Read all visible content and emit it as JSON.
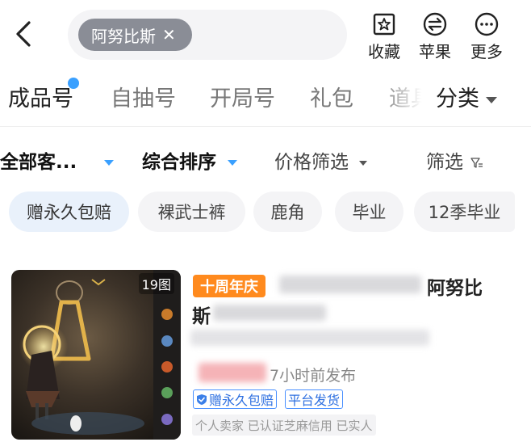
{
  "search": {
    "tag": "阿努比斯"
  },
  "header_actions": [
    {
      "label": "收藏",
      "icon": "star-box-icon"
    },
    {
      "label": "苹果",
      "icon": "apple-swap-icon"
    },
    {
      "label": "更多",
      "icon": "more-dots-icon"
    }
  ],
  "tabs": [
    {
      "label": "成品号",
      "active": true,
      "dot": true
    },
    {
      "label": "自抽号"
    },
    {
      "label": "开局号"
    },
    {
      "label": "礼包"
    },
    {
      "label": "道具"
    },
    {
      "label": "分类"
    }
  ],
  "filters": [
    {
      "label": "全部客..."
    },
    {
      "label": "综合排序",
      "active": true
    },
    {
      "label": "价格筛选"
    },
    {
      "label": "筛选"
    }
  ],
  "chips": [
    {
      "label": "赠永久包赔",
      "active": true
    },
    {
      "label": "裸武士裤"
    },
    {
      "label": "鹿角"
    },
    {
      "label": "毕业"
    },
    {
      "label": "12季毕业"
    }
  ],
  "product": {
    "image_count": "19图",
    "anniversary_badge": "十周年庆",
    "title_visible_1": "阿努比",
    "title_visible_2": "斯",
    "time_text": "7小时前发布",
    "badges": [
      "赠永久包赔",
      "平台发货"
    ],
    "seller_info": "个人卖家 已认证芝麻信用 已实人",
    "colors": {
      "badge_orange": "#ff8a1e",
      "accent_blue": "#3aa0ff"
    }
  }
}
